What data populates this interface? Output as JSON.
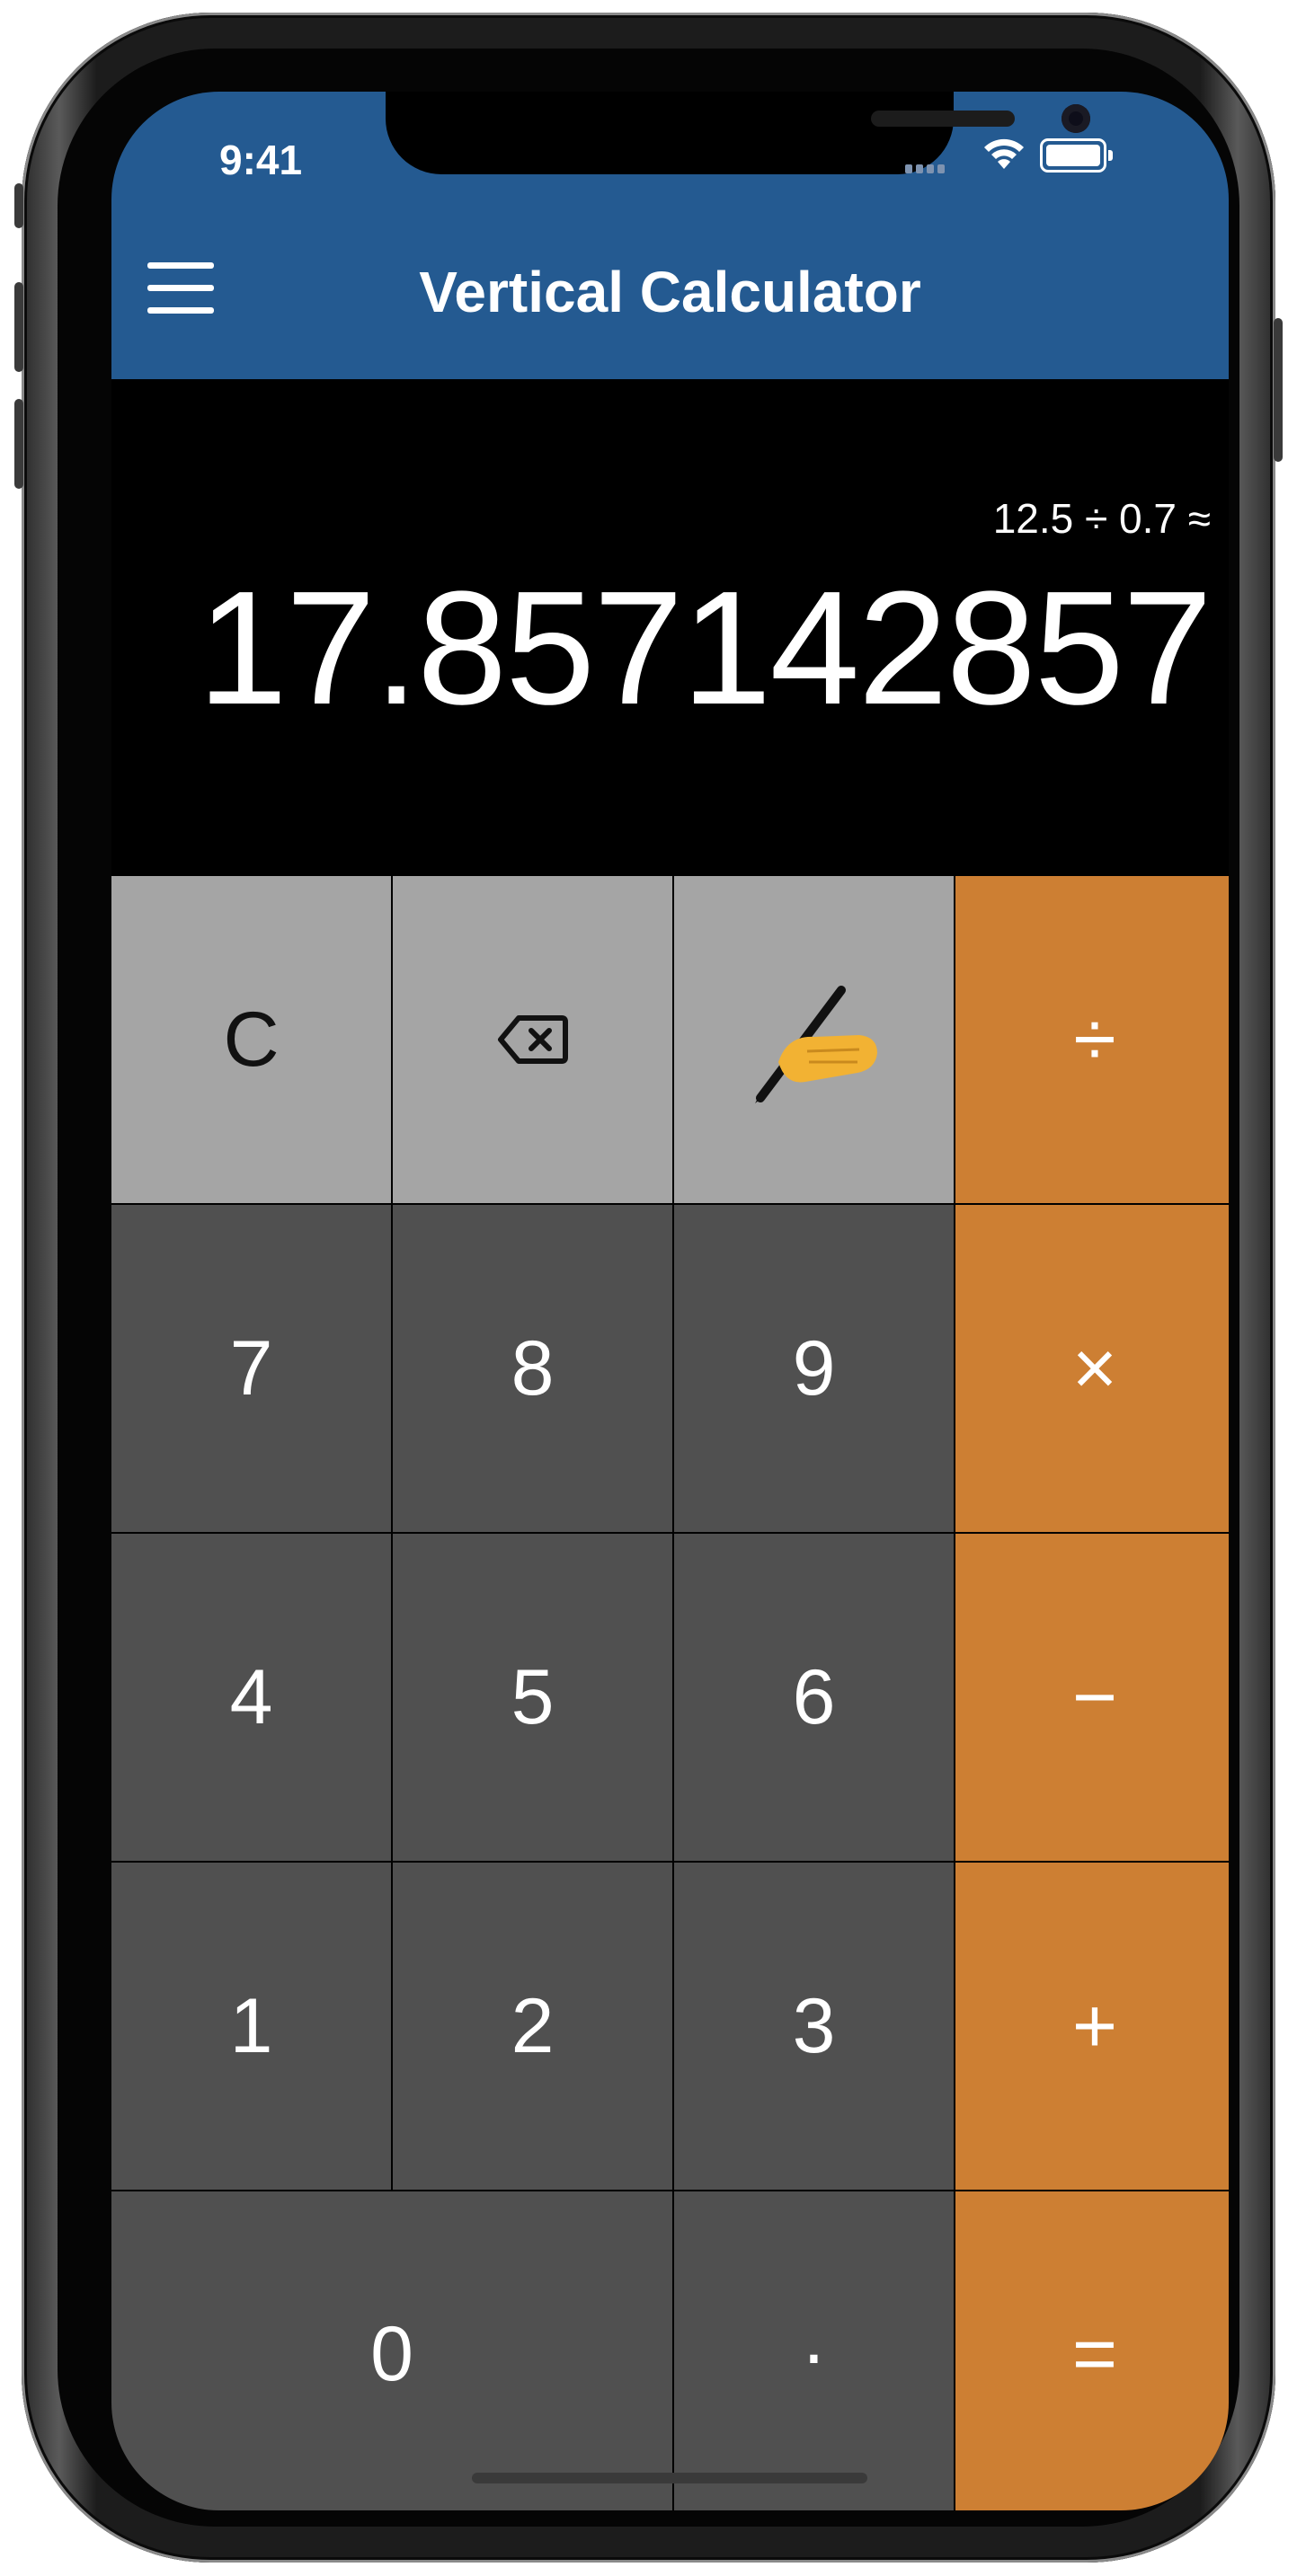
{
  "status_bar": {
    "time": "9:41"
  },
  "app": {
    "title": "Vertical Calculator"
  },
  "display": {
    "expression": "12.5 ÷ 0.7 ≈",
    "result": "17.857142857"
  },
  "keypad": {
    "row1": {
      "clear": "C",
      "backspace_icon": "backspace-icon",
      "handwriting_icon": "writing-hand-icon",
      "divide": "÷"
    },
    "row2": {
      "seven": "7",
      "eight": "8",
      "nine": "9",
      "multiply": "×"
    },
    "row3": {
      "four": "4",
      "five": "5",
      "six": "6",
      "subtract": "−"
    },
    "row4": {
      "one": "1",
      "two": "2",
      "three": "3",
      "add": "+"
    },
    "row5": {
      "zero": "0",
      "decimal": "·",
      "equals": "="
    }
  },
  "colors": {
    "header": "#245a91",
    "function_key": "#a5a5a5",
    "number_key": "#505050",
    "operator_key": "#cd7f33",
    "background": "#000000"
  }
}
